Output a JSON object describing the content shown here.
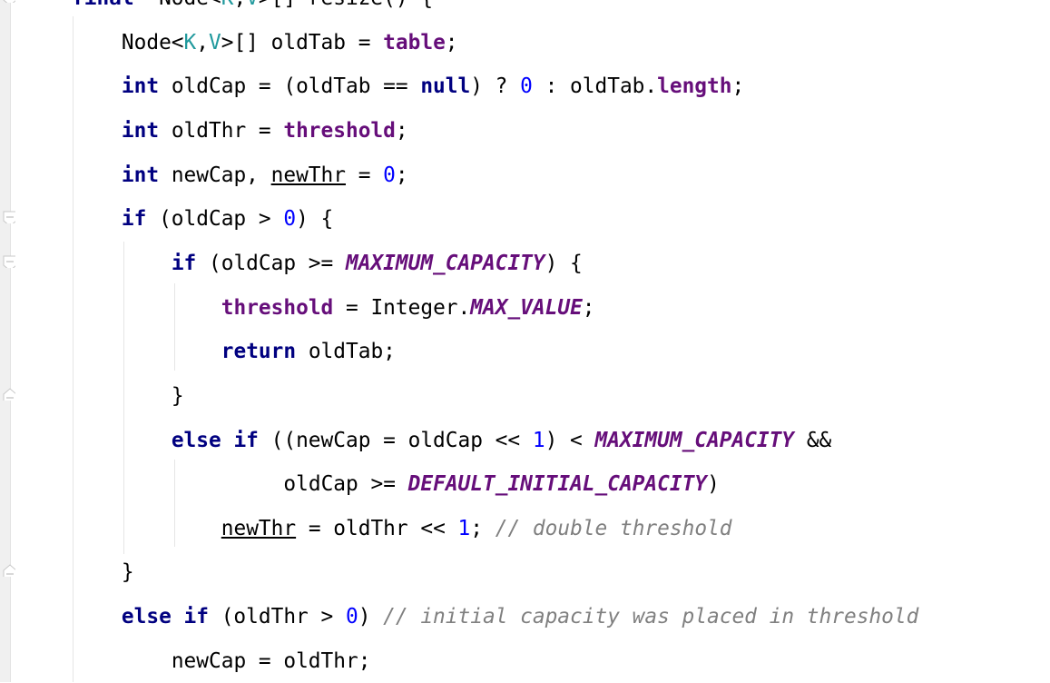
{
  "editor": {
    "language": "Java",
    "colors": {
      "keyword": "#000080",
      "field": "#660E7A",
      "number": "#0000FF",
      "type_param": "#20999D",
      "comment": "#808080"
    },
    "lines": [
      {
        "indent": 0,
        "tokens": [
          [
            "kw",
            "final"
          ],
          [
            "",
            "  Node<"
          ],
          [
            "gen",
            "K"
          ],
          [
            "",
            ","
          ],
          [
            "gen",
            "V"
          ],
          [
            "",
            ">[] resize() {"
          ]
        ]
      },
      {
        "indent": 1,
        "tokens": [
          [
            "",
            "Node<"
          ],
          [
            "gen",
            "K"
          ],
          [
            "",
            ","
          ],
          [
            "gen",
            "V"
          ],
          [
            "",
            ">[] oldTab = "
          ],
          [
            "fld",
            "table"
          ],
          [
            "",
            ";"
          ]
        ]
      },
      {
        "indent": 1,
        "tokens": [
          [
            "kw",
            "int"
          ],
          [
            "",
            " oldCap = (oldTab == "
          ],
          [
            "kw",
            "null"
          ],
          [
            "",
            ") ? "
          ],
          [
            "num",
            "0"
          ],
          [
            "",
            " : oldTab."
          ],
          [
            "fld",
            "length"
          ],
          [
            "",
            ";"
          ]
        ]
      },
      {
        "indent": 1,
        "tokens": [
          [
            "kw",
            "int"
          ],
          [
            "",
            " oldThr = "
          ],
          [
            "fld",
            "threshold"
          ],
          [
            "",
            ";"
          ]
        ]
      },
      {
        "indent": 1,
        "tokens": [
          [
            "kw",
            "int"
          ],
          [
            "",
            " newCap, "
          ],
          [
            "re",
            "newThr"
          ],
          [
            "",
            " = "
          ],
          [
            "num",
            "0"
          ],
          [
            "",
            ";"
          ]
        ]
      },
      {
        "indent": 1,
        "tokens": [
          [
            "kw",
            "if"
          ],
          [
            "",
            " (oldCap > "
          ],
          [
            "num",
            "0"
          ],
          [
            "",
            ") {"
          ]
        ]
      },
      {
        "indent": 2,
        "tokens": [
          [
            "kw",
            "if"
          ],
          [
            "",
            " (oldCap >= "
          ],
          [
            "cst",
            "MAXIMUM_CAPACITY"
          ],
          [
            "",
            ") {"
          ]
        ]
      },
      {
        "indent": 3,
        "tokens": [
          [
            "fld",
            "threshold"
          ],
          [
            "",
            " = Integer."
          ],
          [
            "cst",
            "MAX_VALUE"
          ],
          [
            "",
            ";"
          ]
        ]
      },
      {
        "indent": 3,
        "tokens": [
          [
            "kw",
            "return"
          ],
          [
            "",
            " oldTab;"
          ]
        ]
      },
      {
        "indent": 2,
        "tokens": [
          [
            "",
            "}"
          ]
        ]
      },
      {
        "indent": 2,
        "tokens": [
          [
            "kw",
            "else if"
          ],
          [
            "",
            " ((newCap = oldCap << "
          ],
          [
            "num",
            "1"
          ],
          [
            "",
            ") < "
          ],
          [
            "cst",
            "MAXIMUM_CAPACITY"
          ],
          [
            "",
            " &&"
          ]
        ]
      },
      {
        "indent": 4.25,
        "tokens": [
          [
            "",
            "oldCap >= "
          ],
          [
            "cst",
            "DEFAULT_INITIAL_CAPACITY"
          ],
          [
            "",
            ")"
          ]
        ]
      },
      {
        "indent": 3,
        "tokens": [
          [
            "re",
            "newThr"
          ],
          [
            "",
            " = oldThr << "
          ],
          [
            "num",
            "1"
          ],
          [
            "",
            "; "
          ],
          [
            "cmt",
            "// double threshold"
          ]
        ]
      },
      {
        "indent": 1,
        "tokens": [
          [
            "",
            "}"
          ]
        ]
      },
      {
        "indent": 1,
        "tokens": [
          [
            "kw",
            "else if"
          ],
          [
            "",
            " (oldThr > "
          ],
          [
            "num",
            "0"
          ],
          [
            "",
            ") "
          ],
          [
            "cmt",
            "// initial capacity was placed in threshold"
          ]
        ]
      },
      {
        "indent": 2,
        "tokens": [
          [
            "",
            "newCap = oldThr;"
          ]
        ]
      }
    ]
  }
}
